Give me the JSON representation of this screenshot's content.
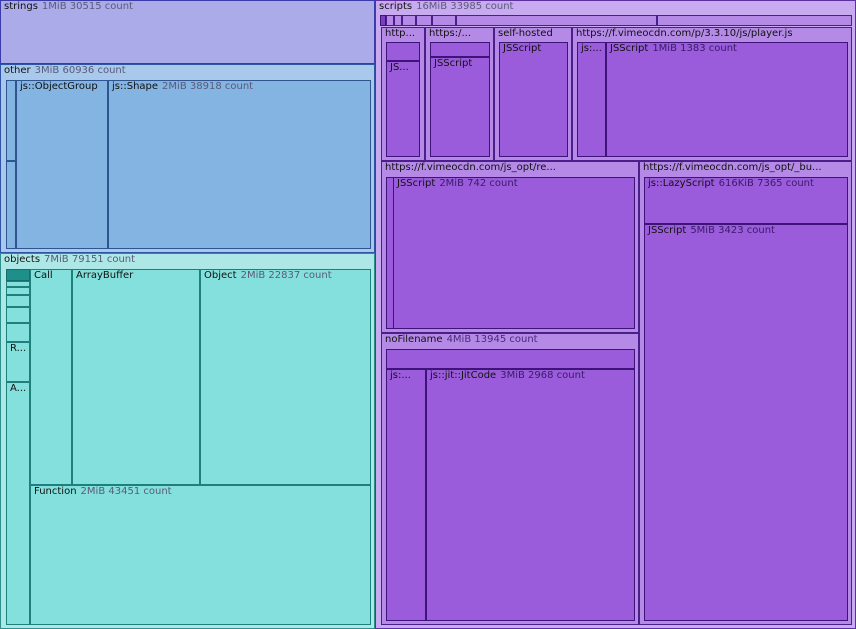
{
  "nodes": {
    "strings": {
      "name": "strings",
      "size": "1MiB",
      "count": "30515 count"
    },
    "other": {
      "name": "other",
      "size": "3MiB",
      "count": "60936 count"
    },
    "objectgroup": {
      "name": "js::ObjectGroup"
    },
    "shape": {
      "name": "js::Shape",
      "size": "2MiB",
      "count": "38918 count"
    },
    "objects": {
      "name": "objects",
      "size": "7MiB",
      "count": "79151 count"
    },
    "r_trunc": {
      "name": "R..."
    },
    "a_trunc": {
      "name": "A..."
    },
    "call": {
      "name": "Call"
    },
    "arraybuffer": {
      "name": "ArrayBuffer"
    },
    "object": {
      "name": "Object",
      "size": "2MiB",
      "count": "22837 count"
    },
    "function": {
      "name": "Function",
      "size": "2MiB",
      "count": "43451 count"
    },
    "scripts": {
      "name": "scripts",
      "size": "16MiB",
      "count": "33985 count"
    },
    "http_trunc": {
      "name": "http..."
    },
    "js_trunc1": {
      "name": "JS..."
    },
    "https_trunc": {
      "name": "https:/..."
    },
    "jsscript_a": {
      "name": "JSScript"
    },
    "selfhosted": {
      "name": "self-hosted"
    },
    "jsscript_b": {
      "name": "JSScript"
    },
    "player": {
      "name": "https://f.vimeocdn.com/p/3.3.10/js/player.js"
    },
    "js_trunc2": {
      "name": "js:..."
    },
    "jsscript_c": {
      "name": "JSScript",
      "size": "1MiB",
      "count": "1383 count"
    },
    "jsopt_re": {
      "name": "https://f.vimeocdn.com/js_opt/re..."
    },
    "jsscript_d": {
      "name": "JSScript",
      "size": "2MiB",
      "count": "742 count"
    },
    "jsopt_bu": {
      "name": "https://f.vimeocdn.com/js_opt/_bu..."
    },
    "lazyscript": {
      "name": "js::LazyScript",
      "size": "616KiB",
      "count": "7365 count"
    },
    "jsscript_e": {
      "name": "JSScript",
      "size": "5MiB",
      "count": "3423 count"
    },
    "nofilename": {
      "name": "noFilename",
      "size": "4MiB",
      "count": "13945 count"
    },
    "js_trunc3": {
      "name": "js:..."
    },
    "jitcode": {
      "name": "js::jit::JitCode",
      "size": "3MiB",
      "count": "2968 count"
    }
  }
}
